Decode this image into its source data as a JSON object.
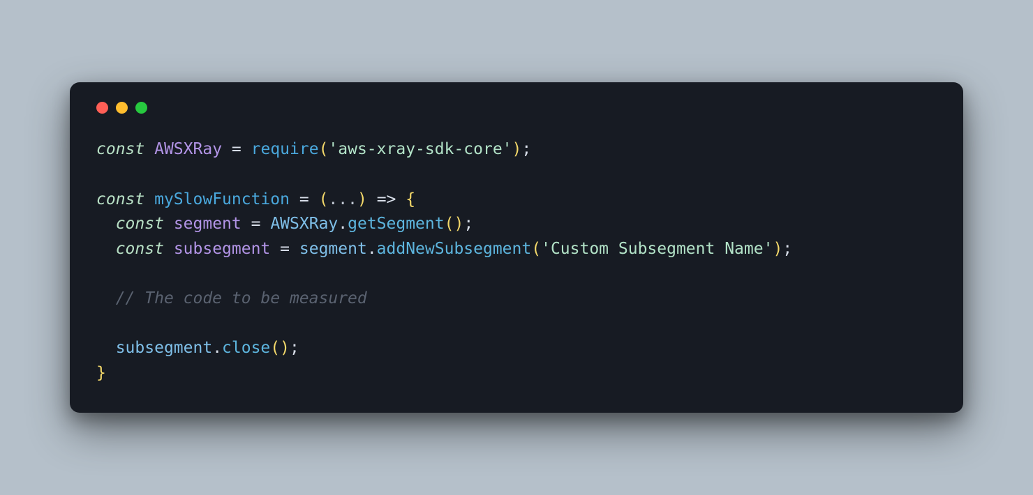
{
  "code": {
    "line1": {
      "kw_const": "const",
      "var_awsxray": "AWSXRay",
      "op_eq": "=",
      "fn_require": "require",
      "paren_open": "(",
      "str_pkg": "'aws-xray-sdk-core'",
      "paren_close": ")",
      "semi": ";"
    },
    "line3": {
      "kw_const": "const",
      "var_fn": "mySlowFunction",
      "op_eq": "=",
      "paren_open": "(",
      "dots": "...",
      "paren_close": ")",
      "arrow": "=>",
      "brace_open": "{"
    },
    "line4": {
      "indent": "  ",
      "kw_const": "const",
      "var_segment": "segment",
      "op_eq": "=",
      "obj": "AWSXRay",
      "dot": ".",
      "method": "getSegment",
      "paren_open": "(",
      "paren_close": ")",
      "semi": ";"
    },
    "line5": {
      "indent": "  ",
      "kw_const": "const",
      "var_subsegment": "subsegment",
      "op_eq": "=",
      "obj": "segment",
      "dot": ".",
      "method": "addNewSubsegment",
      "paren_open": "(",
      "str_name": "'Custom Subsegment Name'",
      "paren_close": ")",
      "semi": ";"
    },
    "line7": {
      "indent": "  ",
      "comment": "// The code to be measured"
    },
    "line9": {
      "indent": "  ",
      "obj": "subsegment",
      "dot": ".",
      "method": "close",
      "paren_open": "(",
      "paren_close": ")",
      "semi": ";"
    },
    "line10": {
      "brace_close": "}"
    }
  }
}
